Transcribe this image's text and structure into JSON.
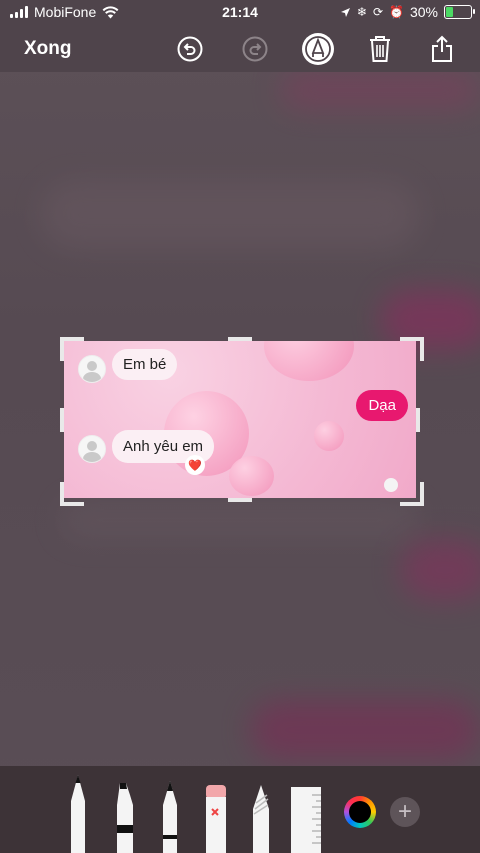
{
  "status_bar": {
    "carrier": "MobiFone",
    "time": "21:14",
    "battery": "30%",
    "battery_level": 0.3
  },
  "toolbar": {
    "done_label": "Xong"
  },
  "chat": {
    "messages": [
      {
        "text": "Em bé",
        "side": "left"
      },
      {
        "text": "Dạa",
        "side": "right"
      },
      {
        "text": "Anh yêu em",
        "side": "left"
      }
    ],
    "reaction": "❤️"
  },
  "tools": [
    "pen",
    "marker",
    "pencil",
    "eraser",
    "lasso",
    "ruler"
  ],
  "colors": {
    "accent_pink": "#e8186f",
    "toolbar_bg": "#4f444b",
    "tray_bg": "#3d3337"
  }
}
